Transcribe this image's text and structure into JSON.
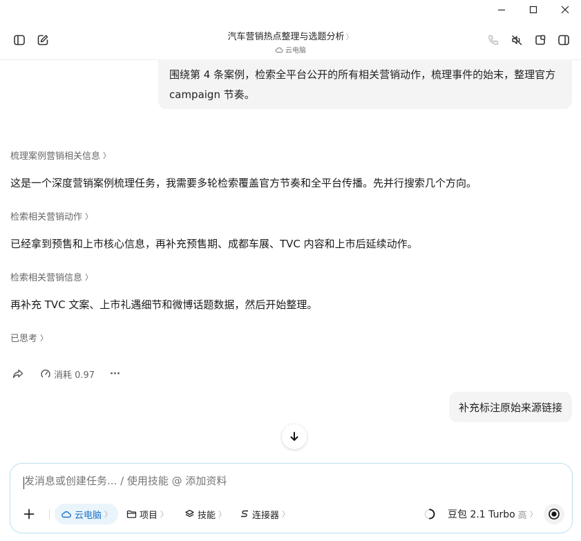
{
  "window": {
    "controls": [
      "minimize-icon",
      "maximize-icon",
      "close-icon"
    ]
  },
  "header": {
    "title": "汽车营销热点整理与选题分析",
    "title_chevron": "〉",
    "subtitle": "云电脑"
  },
  "messages": {
    "user_1": "围绕第 4 条案例，检索全平台公开的所有相关营销动作，梳理事件的始末，整理官方 campaign 节奏。",
    "section_1_label": "梳理案例营销相关信息",
    "para_1": "这是一个深度营销案例梳理任务，我需要多轮检索覆盖官方节奏和全平台传播。先并行搜索几个方向。",
    "section_2_label": "检索相关营销动作",
    "para_2": "已经拿到预售和上市核心信息，再补充预售期、成都车展、TVC 内容和上市后延续动作。",
    "section_3_label": "检索相关营销信息",
    "para_3": "再补充 TVC 文案、上市礼遇细节和微博话题数据，然后开始整理。",
    "thought_label": "已思考",
    "chevron": "〉",
    "cost_label": "消耗 0.97",
    "more": "···",
    "user_2": "补充标注原始来源链接"
  },
  "composer": {
    "placeholder": "发消息或创建任务... / 使用技能 @ 添加资料",
    "chip_cloud": "云电脑",
    "chip_project": "项目",
    "chip_skill": "技能",
    "chip_connector": "连接器",
    "chevron": "〉",
    "model": "豆包 2.1 Turbo",
    "model_level": "高"
  },
  "colors": {
    "accent": "#1a73c7",
    "composer_border": "#b9dff2",
    "bubble_bg": "#f4f4f5"
  }
}
